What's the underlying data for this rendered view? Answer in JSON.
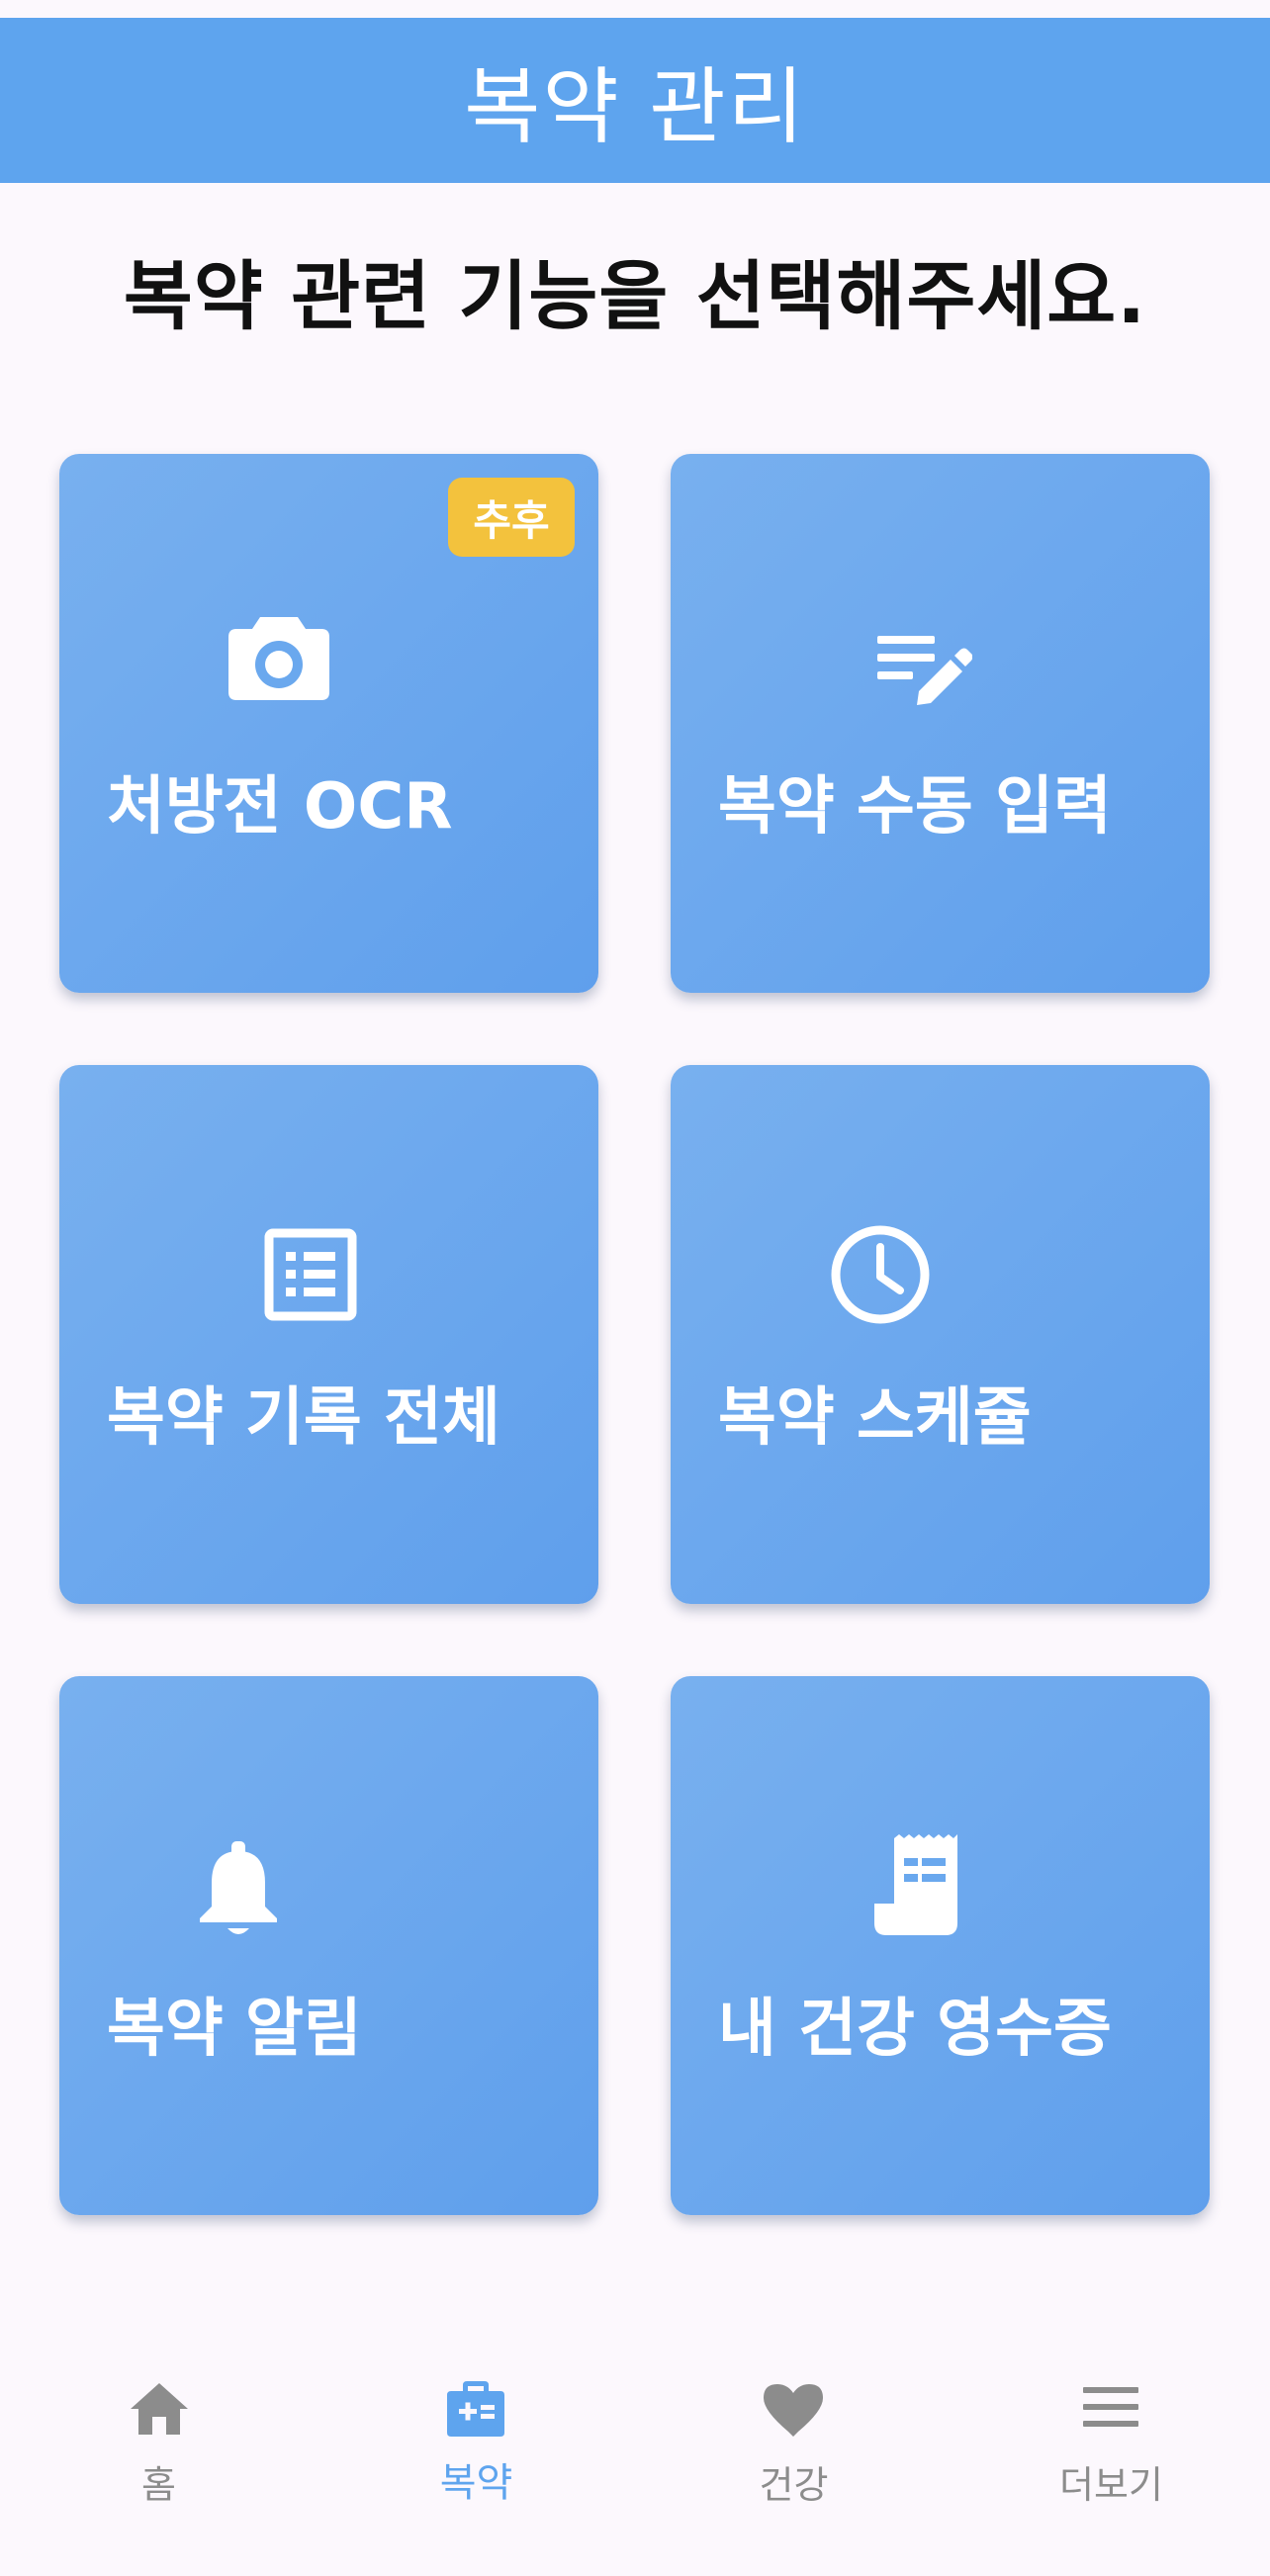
{
  "app_bar": {
    "title": "복약 관리"
  },
  "main": {
    "prompt": "복약 관련 기능을 선택해주세요."
  },
  "cards": [
    {
      "label": "처방전 OCR",
      "icon": "camera-icon",
      "badge": "추후"
    },
    {
      "label": "복약 수동 입력",
      "icon": "edit-note-icon"
    },
    {
      "label": "복약 기록 전체",
      "icon": "list-icon"
    },
    {
      "label": "복약 스케쥴",
      "icon": "clock-icon"
    },
    {
      "label": "복약 알림",
      "icon": "bell-icon"
    },
    {
      "label": "내 건강 영수증",
      "icon": "receipt-icon"
    }
  ],
  "bottom_nav": {
    "items": [
      {
        "label": "홈",
        "icon": "home-icon",
        "active": false
      },
      {
        "label": "복약",
        "icon": "medical-kit-icon",
        "active": true
      },
      {
        "label": "건강",
        "icon": "heart-icon",
        "active": false
      },
      {
        "label": "더보기",
        "icon": "menu-icon",
        "active": false
      }
    ]
  },
  "colors": {
    "primary": "#5ea4ee",
    "badge": "#f3c23d",
    "background": "#fcf8fd",
    "inactive_nav": "#8c8c8c"
  }
}
